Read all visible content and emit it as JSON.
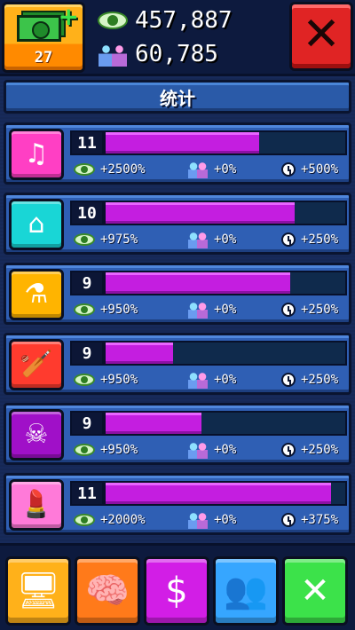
{
  "header": {
    "cash_count": "27",
    "views": "457,887",
    "fans": "60,785"
  },
  "title": "统计",
  "categories": [
    {
      "name": "music-category",
      "icon": "music-notes-icon",
      "icon_glyph": "♫",
      "icon_bg": "#ff3fc4",
      "level": "11",
      "progress": 0.64,
      "views_bonus": "+2500%",
      "fans_bonus": "+0%",
      "time_bonus": "+500%"
    },
    {
      "name": "vlog-category",
      "icon": "house-icon",
      "icon_glyph": "⌂",
      "icon_bg": "#19d6d6",
      "level": "10",
      "progress": 0.79,
      "views_bonus": "+975%",
      "fans_bonus": "+0%",
      "time_bonus": "+250%"
    },
    {
      "name": "science-category",
      "icon": "flask-icon",
      "icon_glyph": "⚗",
      "icon_bg": "#ffb400",
      "level": "9",
      "progress": 0.77,
      "views_bonus": "+950%",
      "fans_bonus": "+0%",
      "time_bonus": "+250%"
    },
    {
      "name": "sports-category",
      "icon": "cricket-bat-icon",
      "icon_glyph": "🏏",
      "icon_bg": "#ff3b2e",
      "level": "9",
      "progress": 0.28,
      "views_bonus": "+950%",
      "fans_bonus": "+0%",
      "time_bonus": "+250%"
    },
    {
      "name": "horror-category",
      "icon": "skull-icon",
      "icon_glyph": "☠",
      "icon_bg": "#a010c8",
      "level": "9",
      "progress": 0.4,
      "views_bonus": "+950%",
      "fans_bonus": "+0%",
      "time_bonus": "+250%"
    },
    {
      "name": "beauty-category",
      "icon": "makeup-mirror-icon",
      "icon_glyph": "💄",
      "icon_bg": "#ff7ad9",
      "level": "11",
      "progress": 0.94,
      "views_bonus": "+2000%",
      "fans_bonus": "+0%",
      "time_bonus": "+375%"
    }
  ],
  "bottom_nav": [
    {
      "name": "computer-upgrade-button",
      "icon": "computer-icon",
      "icon_glyph": "🖥",
      "bg": "#ffb11a"
    },
    {
      "name": "brain-upgrade-button",
      "icon": "brain-upgrade-icon",
      "icon_glyph": "🧠",
      "bg": "#ff7a1a"
    },
    {
      "name": "shop-button",
      "icon": "shop-icon",
      "icon_glyph": "$",
      "bg": "#d21ee6"
    },
    {
      "name": "fans-button",
      "icon": "people-chat-icon",
      "icon_glyph": "👥",
      "bg": "#36a6ff"
    },
    {
      "name": "map-button",
      "icon": "treasure-map-icon",
      "icon_glyph": "✕",
      "bg": "#3ce24a"
    }
  ]
}
